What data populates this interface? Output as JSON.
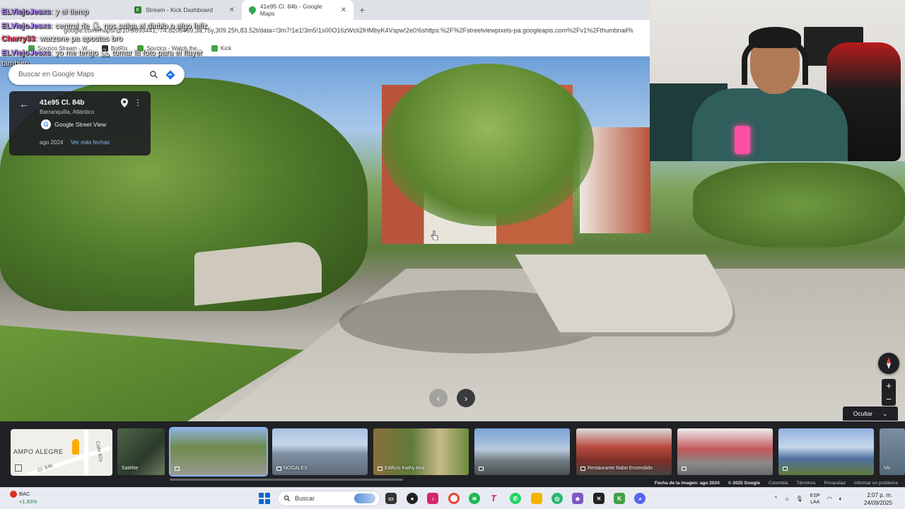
{
  "browser": {
    "tabs": [
      {
        "label": "Stream - Kick Dashboard",
        "active": false
      },
      {
        "label": "41e95 Cl. 84b - Google Maps",
        "active": true
      }
    ],
    "url": "google.com/maps/@10.9893441,-74.8206469,3a,75y,309.25h,83.52t/data=!3m7!1e1!3m5!1s00O16zWcli2lHMbyK4Vspw!2e0!6shttps:%2F%2Fstreetviewpixels-pa.googleapis.com%2Fv1%2Fthumbnail%",
    "bookmarks": [
      {
        "label": "Sovzico Stream - W..."
      },
      {
        "label": "BotRix"
      },
      {
        "label": "Sovzico - Watch the..."
      },
      {
        "label": "Kick"
      }
    ]
  },
  "chat": [
    {
      "user": "ELViejoJesxs",
      "message": ": y el tiemp"
    },
    {
      "user": "ELViejoJesxs",
      "message": ": central de ⛸ nos salga el diablo o algo feliz"
    },
    {
      "user": "Charry33",
      "message": ": warzone pa apostas bro"
    },
    {
      "user": "ELViejoJesxs",
      "message": ": yo me tengo ⛸ tomar la foto para el flayer"
    },
    {
      "user": "",
      "message": "tambien"
    }
  ],
  "maps": {
    "search_placeholder": "Buscar en Google Maps",
    "place": {
      "address": "41e95 Cl. 84b",
      "city": "Barranquilla, Atlántico",
      "source": "Google Street View",
      "date": "ago 2024",
      "more_dates": "Ver más fechas"
    },
    "hide_label": "Ocultar",
    "zoom_in": "+",
    "zoom_out": "−",
    "minimap": {
      "area": "AMPO ALEGRE",
      "street1": "Cl. 84b",
      "street2": "Calle 82a"
    },
    "thumbnails": [
      {
        "caption": "Satélite",
        "color": "#3f5a3a",
        "icon": false
      },
      {
        "caption": "",
        "color": "#6f8a4c",
        "icon": true
      },
      {
        "caption": "NOGALES",
        "color": "#7f8fa3",
        "icon": true
      },
      {
        "caption": "Edificio Kathy Ana",
        "color": "#5d7b3a",
        "icon": true
      },
      {
        "caption": "",
        "color": "#8fa6bf",
        "icon": true
      },
      {
        "caption": "Restaurante Rabo Encendido",
        "color": "#b84a3f",
        "icon": true
      },
      {
        "caption": "",
        "color": "#c2565a",
        "icon": true
      },
      {
        "caption": "",
        "color": "#6b8fbf",
        "icon": true
      },
      {
        "caption": "Mir",
        "color": "#546a7b",
        "icon": true
      }
    ],
    "footer": {
      "image_date": "Fecha de la imagen: ago 2024",
      "copyright": "© 2025 Google",
      "country": "Colombia",
      "terms": "Términos",
      "privacy": "Privacidad",
      "report": "Informar un problema"
    }
  },
  "taskbar": {
    "weather_label": "BAC",
    "weather_value": "+1,93%",
    "search_placeholder": "Buscar",
    "lang_top": "ESP",
    "lang_bottom": "LAA",
    "time": "2:07 p. m.",
    "date": "24/09/2025"
  }
}
